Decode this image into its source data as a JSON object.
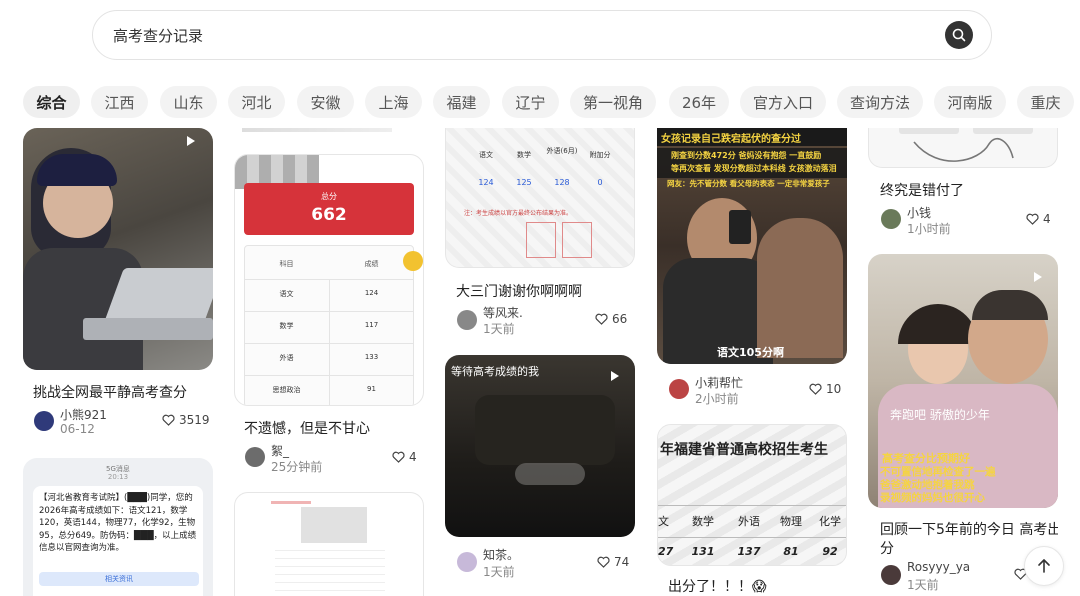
{
  "search": {
    "query": "高考查分记录"
  },
  "tabs": [
    "综合",
    "江西",
    "山东",
    "河北",
    "安徽",
    "上海",
    "福建",
    "辽宁",
    "第一视角",
    "26年",
    "官方入口",
    "查询方法",
    "河南版",
    "重庆"
  ],
  "cards": {
    "c1": {
      "title": "挑战全网最平静高考查分",
      "author": "小熊921",
      "time": "06-12",
      "likes": "3519"
    },
    "c2": {
      "title": "不遗憾，但是不甘心",
      "author": "絮_",
      "time": "25分钟前",
      "likes": "4",
      "score_label": "总分",
      "score": "662",
      "table_header": [
        "科目",
        "成绩"
      ],
      "rows": [
        [
          "语文",
          "124"
        ],
        [
          "数学",
          "117"
        ],
        [
          "外语",
          "133"
        ],
        [
          "思想政治",
          "91"
        ]
      ]
    },
    "c3": {
      "title": "大三门谢谢你啊啊啊",
      "author": "等风来.",
      "time": "1天前",
      "likes": "66",
      "headers": [
        "语文",
        "数学",
        "外语(6月)",
        "附加分"
      ],
      "values": [
        "124",
        "125",
        "128",
        "0"
      ],
      "note": "注：考生成绩以官方最终公布结果为准。"
    },
    "c4": {
      "title": "",
      "author": "知茶。",
      "time": "1天前",
      "likes": "74",
      "overlay": "等待高考成绩的我"
    },
    "c5": {
      "title": "",
      "author": "小莉帮忙",
      "time": "2小时前",
      "likes": "10",
      "banner1": "女孩记录自己跌宕起伏的查分过",
      "banner2": "刚查到分数472分 爸妈没有抱怨 一直鼓励",
      "banner3": "等再次查看 发现分数超过本科线 女孩激动落泪",
      "banner4": "网友：先不管分数 看父母的表态 一定非常爱孩子",
      "caption": "语文105分啊"
    },
    "c6": {
      "title": "出分了！！！😱",
      "header": "年福建省普通高校招生考生",
      "headers": [
        "文",
        "数学",
        "外语",
        "物理",
        "化学"
      ],
      "values": [
        "27",
        "131",
        "137",
        "81",
        "92"
      ]
    },
    "c7": {
      "title": "终究是错付了",
      "author": "小钱",
      "time": "1小时前",
      "likes": "4"
    },
    "c8": {
      "title1": "回顾一下5年前的今日 高考出",
      "title2": "分",
      "author": "Rosyyy_ya",
      "time": "1天前",
      "overlay1": "奔跑吧 骄傲的少年",
      "overlay2": "高考查分比预期好",
      "overlay3": "不可置信地再检查了一遍",
      "overlay4": "爸爸激动地抱着我跳",
      "overlay5": "录视频的妈妈也很开心"
    },
    "c9": {
      "sms_header": "5G消息",
      "sms_time": "20:13",
      "sms_text": "【河北省教育考试院】(███)同学，您的2026年高考成绩如下：语文121，数学120，英语144，物理77，化学92，生物95，总分649。防伪码：███，以上成绩信息以官网查询为准。",
      "sms_button": "相关资讯"
    }
  },
  "colors": {
    "accent": "#d63a3a",
    "banner_yellow": "#f5d442",
    "text": "#222222"
  }
}
